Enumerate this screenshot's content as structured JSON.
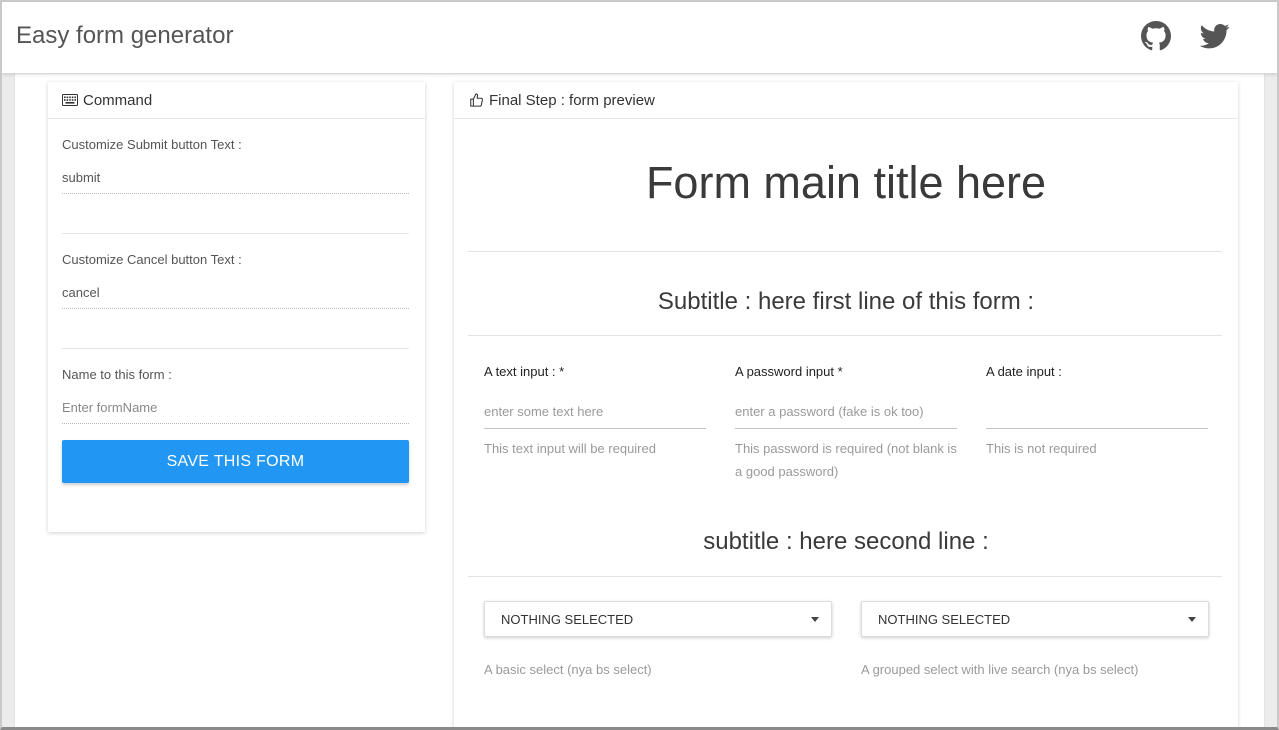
{
  "header": {
    "brand": "Easy form generator",
    "icons": [
      "github-icon",
      "twitter-icon"
    ]
  },
  "command": {
    "title": "Command",
    "submit_label": "Customize Submit button Text :",
    "submit_value": "submit",
    "cancel_label": "Customize Cancel button Text :",
    "cancel_value": "cancel",
    "name_label": "Name to this form :",
    "name_placeholder": "Enter formName",
    "save_button": "SAVE THIS FORM"
  },
  "preview": {
    "title": "Final Step : form preview",
    "form_title": "Form main title here",
    "subtitle1": "Subtitle : here first line of this form :",
    "text_input": {
      "label": "A text input : *",
      "placeholder": "enter some text here",
      "help": "This text input will be required"
    },
    "password_input": {
      "label": "A password input *",
      "placeholder": "enter a password (fake is ok too)",
      "help": "This password is required (not blank is a good password)"
    },
    "date_input": {
      "label": "A date input :",
      "placeholder": "",
      "help": "This is not required"
    },
    "subtitle2": "subtitle : here second line :",
    "select_basic": {
      "value": "NOTHING SELECTED",
      "help": "A basic select (nya bs select)"
    },
    "select_grouped": {
      "value": "NOTHING SELECTED",
      "help": "A grouped select with live search (nya bs select)"
    }
  },
  "colors": {
    "accent": "#2196f3"
  }
}
